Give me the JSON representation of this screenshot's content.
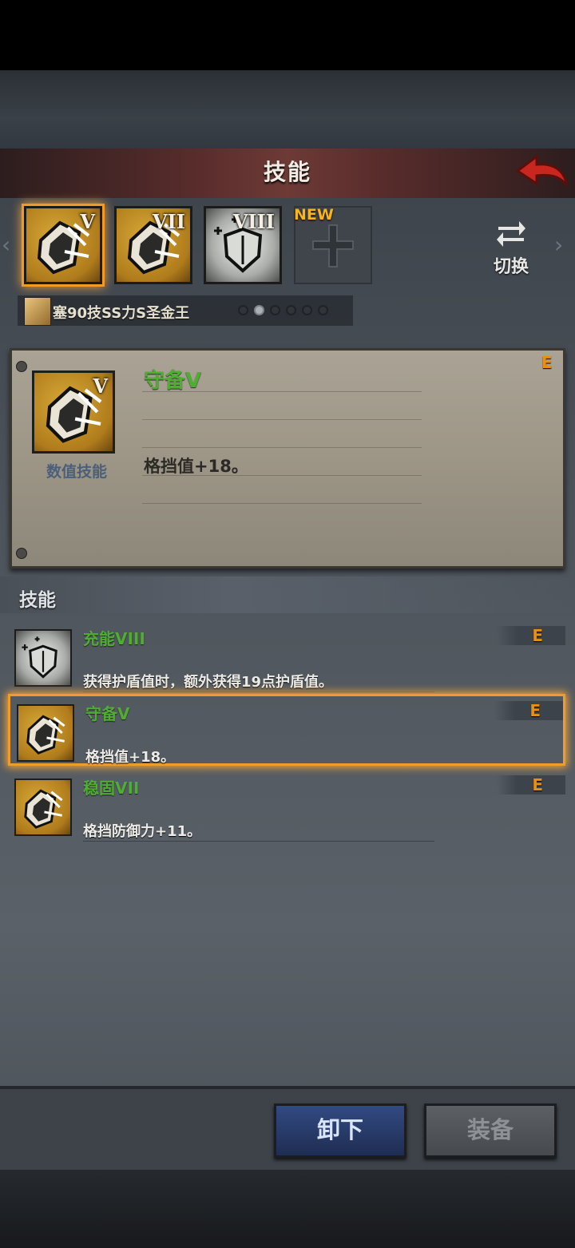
{
  "header": {
    "title": "技能"
  },
  "slots": [
    {
      "tier": "V",
      "style": "gold",
      "selected": true
    },
    {
      "tier": "VII",
      "style": "gold",
      "selected": false
    },
    {
      "tier": "VIII",
      "style": "silver",
      "selected": false
    },
    {
      "tier": "",
      "style": "empty",
      "badge": "NEW"
    }
  ],
  "switch": {
    "label": "切换"
  },
  "hero": {
    "name": "塞90技SS力S圣金王"
  },
  "pager": {
    "count": 6,
    "active": 1
  },
  "detail": {
    "tier": "V",
    "name": "守备V",
    "type": "数值技能",
    "description": "格挡值+18。",
    "grade": "E"
  },
  "skills_section": {
    "title": "技能"
  },
  "skills": [
    {
      "name": "充能VIII",
      "description": "获得护盾值时，额外获得19点护盾值。",
      "grade": "E",
      "icon": "shield-charge-icon"
    },
    {
      "name": "守备V",
      "description": "格挡值+18。",
      "grade": "E",
      "icon": "shield-break-icon"
    },
    {
      "name": "稳固VII",
      "description": "格挡防御力+11。",
      "grade": "E",
      "icon": "shield-break-icon"
    }
  ],
  "actions": {
    "unequip": "卸下",
    "equip": "装备"
  },
  "colors": {
    "accent": "#f29a26",
    "skill_name": "#4fae32",
    "grade": "#e88f14"
  }
}
